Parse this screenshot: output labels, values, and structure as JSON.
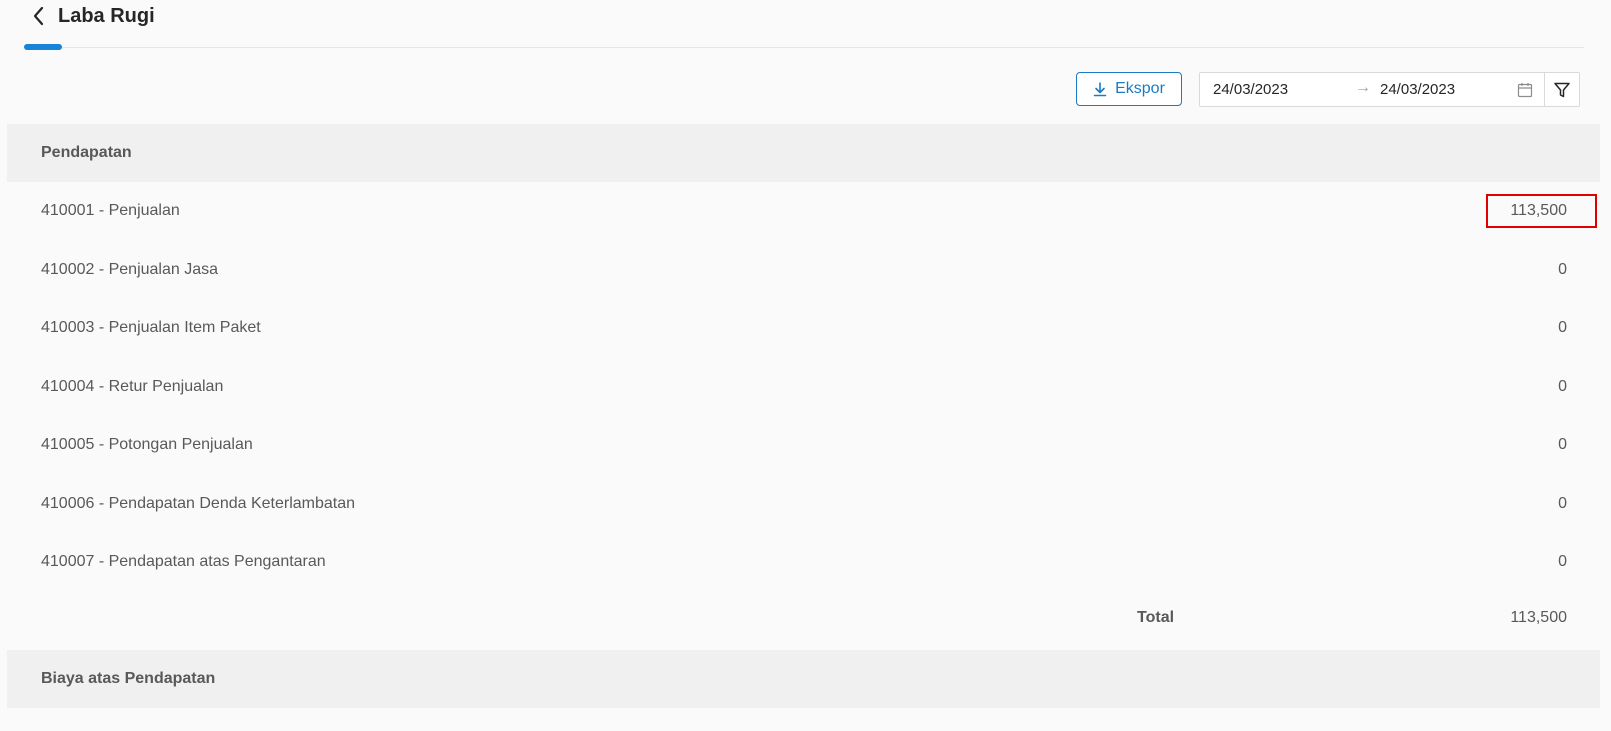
{
  "header": {
    "title": "Laba Rugi",
    "back_icon": "chevron-left-icon"
  },
  "toolbar": {
    "export_label": "Ekspor",
    "export_icon": "download-icon",
    "date_start": "24/03/2023",
    "date_separator": "→",
    "date_end": "24/03/2023",
    "calendar_icon": "calendar-icon",
    "filter_icon": "filter-icon"
  },
  "sections": [
    {
      "title": "Pendapatan",
      "rows": [
        {
          "name": "410001 - Penjualan",
          "amount": "113,500"
        },
        {
          "name": "410002 - Penjualan Jasa",
          "amount": "0"
        },
        {
          "name": "410003 - Penjualan Item Paket",
          "amount": "0"
        },
        {
          "name": "410004 - Retur Penjualan",
          "amount": "0"
        },
        {
          "name": "410005 - Potongan Penjualan",
          "amount": "0"
        },
        {
          "name": "410006 - Pendapatan Denda Keterlambatan",
          "amount": "0"
        },
        {
          "name": "410007 - Pendapatan atas Pengantaran",
          "amount": "0"
        }
      ],
      "total_label": "Total",
      "total_amount": "113,500"
    },
    {
      "title": "Biaya atas Pendapatan"
    }
  ],
  "colors": {
    "accent": "#1784d8",
    "highlight_box": "#e00000",
    "section_bg": "#f0f0f0"
  }
}
